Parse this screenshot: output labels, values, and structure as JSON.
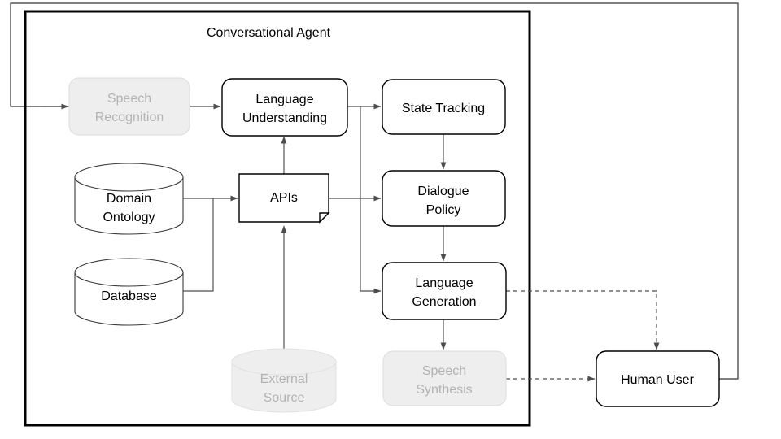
{
  "diagram": {
    "title": "Conversational Agent",
    "nodes": {
      "speech_recognition": {
        "label_line1": "Speech",
        "label_line2": "Recognition",
        "state": "disabled"
      },
      "language_understanding": {
        "label_line1": "Language",
        "label_line2": "Understanding",
        "state": "active"
      },
      "state_tracking": {
        "label_line1": "State Tracking",
        "label_line2": "",
        "state": "active"
      },
      "dialogue_policy": {
        "label_line1": "Dialogue",
        "label_line2": "Policy",
        "state": "active"
      },
      "language_generation": {
        "label_line1": "Language",
        "label_line2": "Generation",
        "state": "active"
      },
      "speech_synthesis": {
        "label_line1": "Speech",
        "label_line2": "Synthesis",
        "state": "disabled"
      },
      "apis": {
        "label_line1": "APIs",
        "label_line2": "",
        "state": "active"
      },
      "domain_ontology": {
        "label_line1": "Domain",
        "label_line2": "Ontology",
        "state": "active"
      },
      "database": {
        "label_line1": "Database",
        "label_line2": "",
        "state": "active"
      },
      "external_source": {
        "label_line1": "External",
        "label_line2": "Source",
        "state": "disabled"
      },
      "human_user": {
        "label_line1": "Human User",
        "label_line2": "",
        "state": "active"
      }
    },
    "colors": {
      "stroke": "#000000",
      "edge": "#4d4d4d",
      "disabled_fill": "#eeeeee",
      "disabled_text": "#b3b3b3",
      "frame": "#333333",
      "background": "#ffffff"
    },
    "edges": [
      {
        "from": "human_user",
        "to": "speech_recognition",
        "style": "solid"
      },
      {
        "from": "speech_recognition",
        "to": "language_understanding",
        "style": "solid"
      },
      {
        "from": "language_understanding",
        "to": "state_tracking",
        "style": "solid"
      },
      {
        "from": "language_understanding",
        "to": "language_generation",
        "style": "solid"
      },
      {
        "from": "state_tracking",
        "to": "dialogue_policy",
        "style": "solid"
      },
      {
        "from": "dialogue_policy",
        "to": "language_generation",
        "style": "solid"
      },
      {
        "from": "language_generation",
        "to": "speech_synthesis",
        "style": "solid"
      },
      {
        "from": "apis",
        "to": "language_understanding",
        "style": "solid"
      },
      {
        "from": "apis",
        "to": "dialogue_policy",
        "style": "solid"
      },
      {
        "from": "domain_ontology",
        "to": "apis",
        "style": "solid"
      },
      {
        "from": "database",
        "to": "apis",
        "style": "solid"
      },
      {
        "from": "external_source",
        "to": "apis",
        "style": "solid"
      },
      {
        "from": "language_generation",
        "to": "human_user",
        "style": "dashed"
      },
      {
        "from": "speech_synthesis",
        "to": "human_user",
        "style": "dashed"
      }
    ]
  }
}
